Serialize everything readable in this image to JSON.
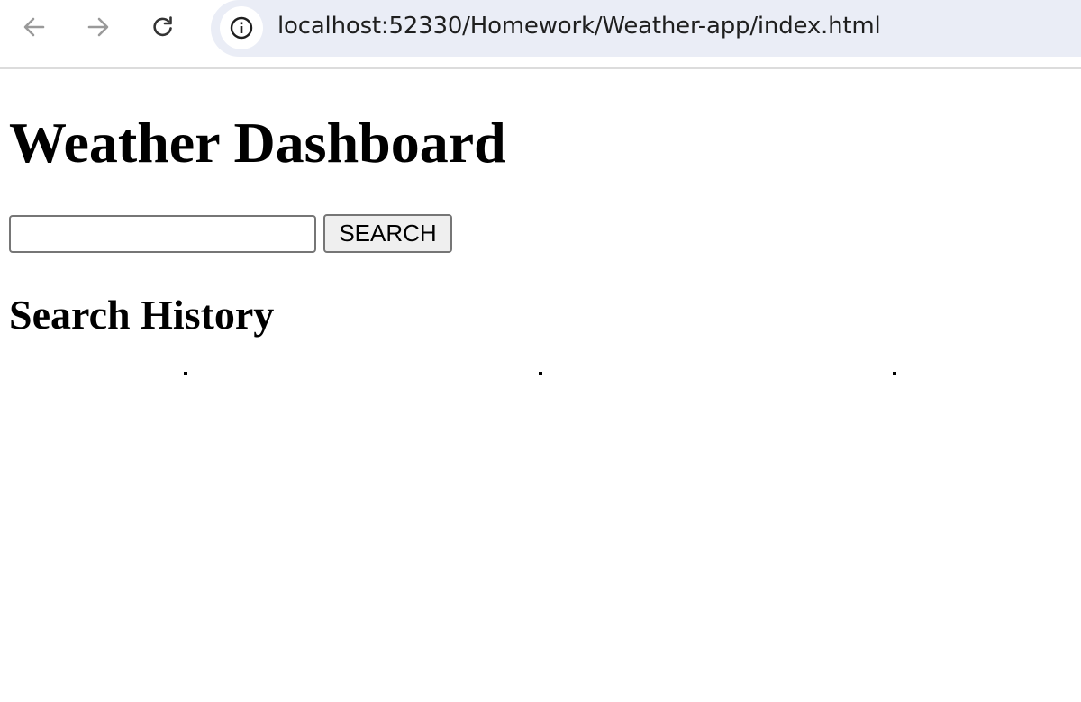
{
  "browser": {
    "back_icon": "arrow-left-icon",
    "forward_icon": "arrow-right-icon",
    "reload_icon": "reload-icon",
    "site_info_icon": "info-circle-icon",
    "url": "localhost:52330/Homework/Weather-app/index.html",
    "omnibox_color": "#eaedf6"
  },
  "page": {
    "title": "Weather Dashboard",
    "search": {
      "value": "",
      "button_label": "SEARCH"
    },
    "history_heading": "Search History",
    "forecast_cards": [
      {
        "content": ""
      },
      {
        "content": ""
      },
      {
        "content": ""
      }
    ]
  }
}
